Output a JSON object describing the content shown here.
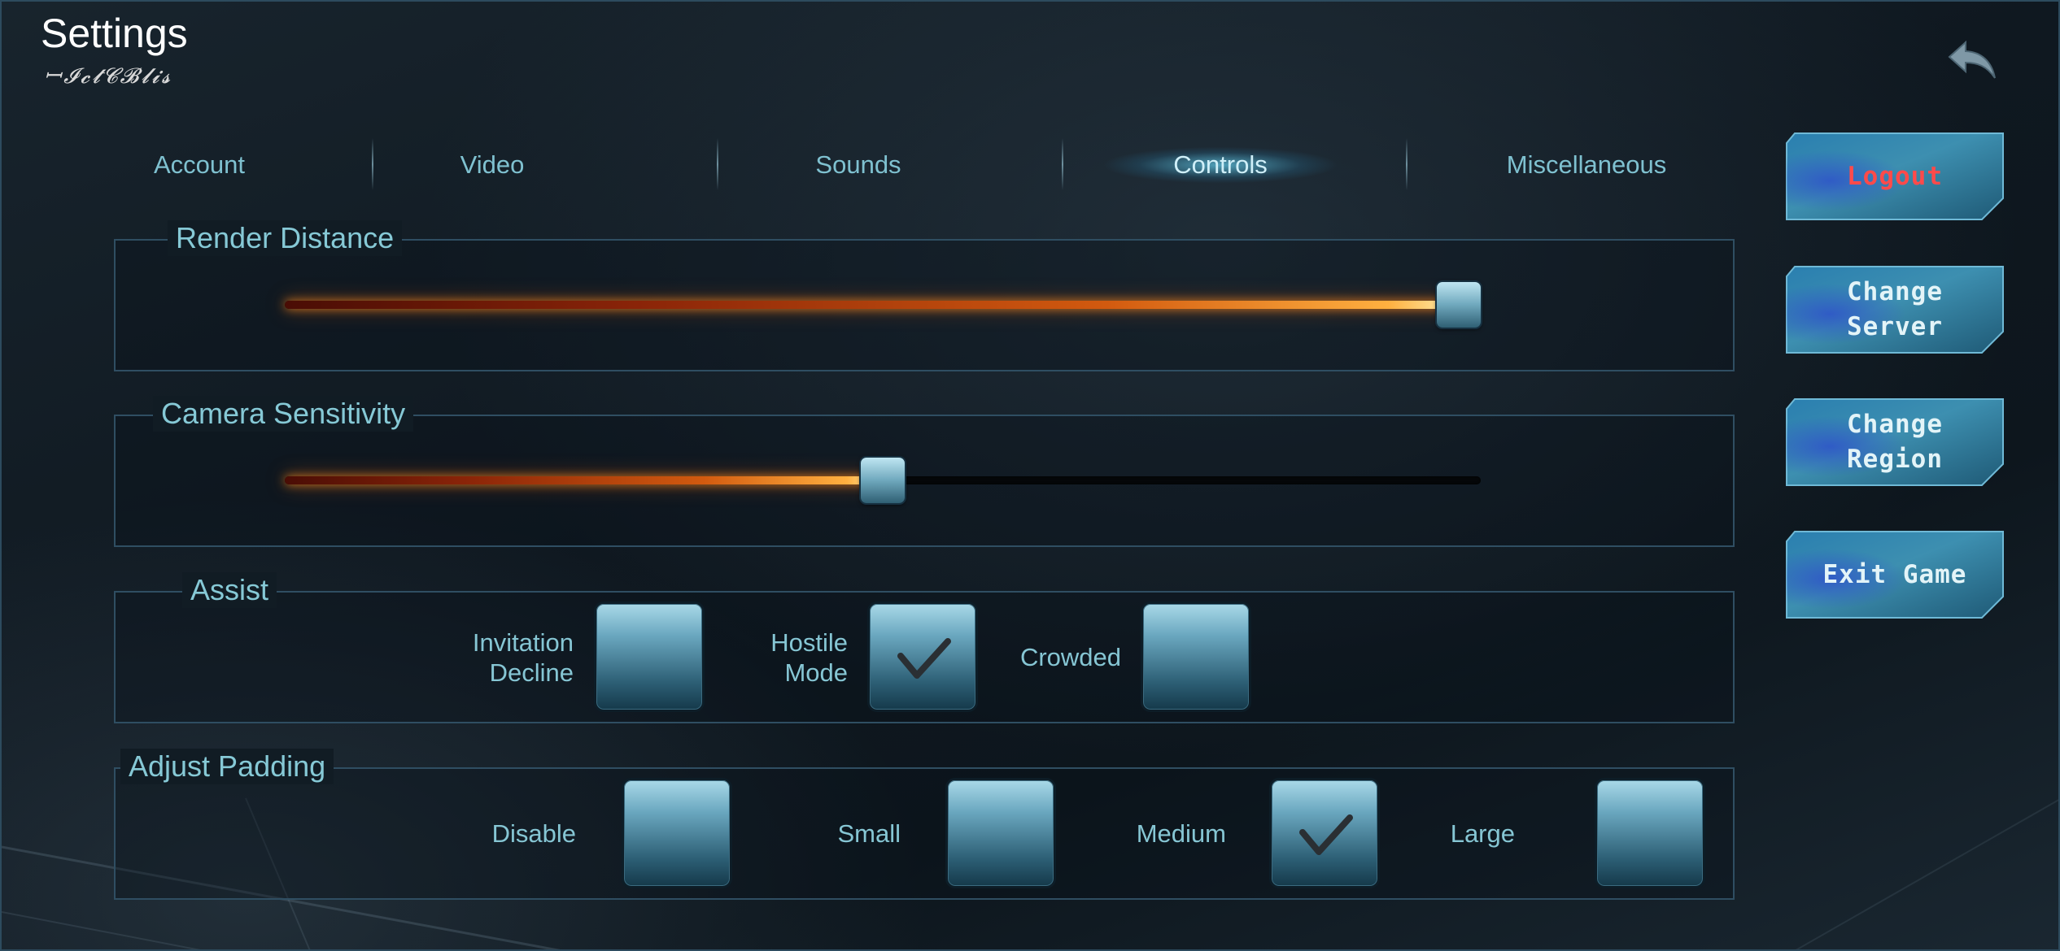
{
  "header": {
    "title": "Settings",
    "subtitle": "ꟷ𝓘𝓬𝓽𝓒𝓑𝓵𝓲𝓼"
  },
  "tabs": [
    {
      "label": "Account",
      "active": false
    },
    {
      "label": "Video",
      "active": false
    },
    {
      "label": "Sounds",
      "active": false
    },
    {
      "label": "Controls",
      "active": true
    },
    {
      "label": "Miscellaneous",
      "active": false
    }
  ],
  "render_distance": {
    "label": "Render Distance",
    "value": 1.0
  },
  "camera_sensitivity": {
    "label": "Camera Sensitivity",
    "value": 0.5
  },
  "assist": {
    "label": "Assist",
    "options": [
      {
        "label": "Invitation\nDecline",
        "checked": false
      },
      {
        "label": "Hostile\nMode",
        "checked": true
      },
      {
        "label": "Crowded",
        "checked": false
      }
    ]
  },
  "padding": {
    "label": "Adjust Padding",
    "options": [
      {
        "label": "Disable",
        "checked": false
      },
      {
        "label": "Small",
        "checked": false
      },
      {
        "label": "Medium",
        "checked": true
      },
      {
        "label": "Large",
        "checked": false
      }
    ]
  },
  "side_buttons": {
    "logout": "Logout",
    "change_server": "Change\nServer",
    "change_region": "Change\nRegion",
    "exit_game": "Exit Game"
  },
  "colors": {
    "accent_text": "#86c9d6",
    "slider_glow": "#ffb040",
    "logout_red": "#ff4a4a"
  }
}
